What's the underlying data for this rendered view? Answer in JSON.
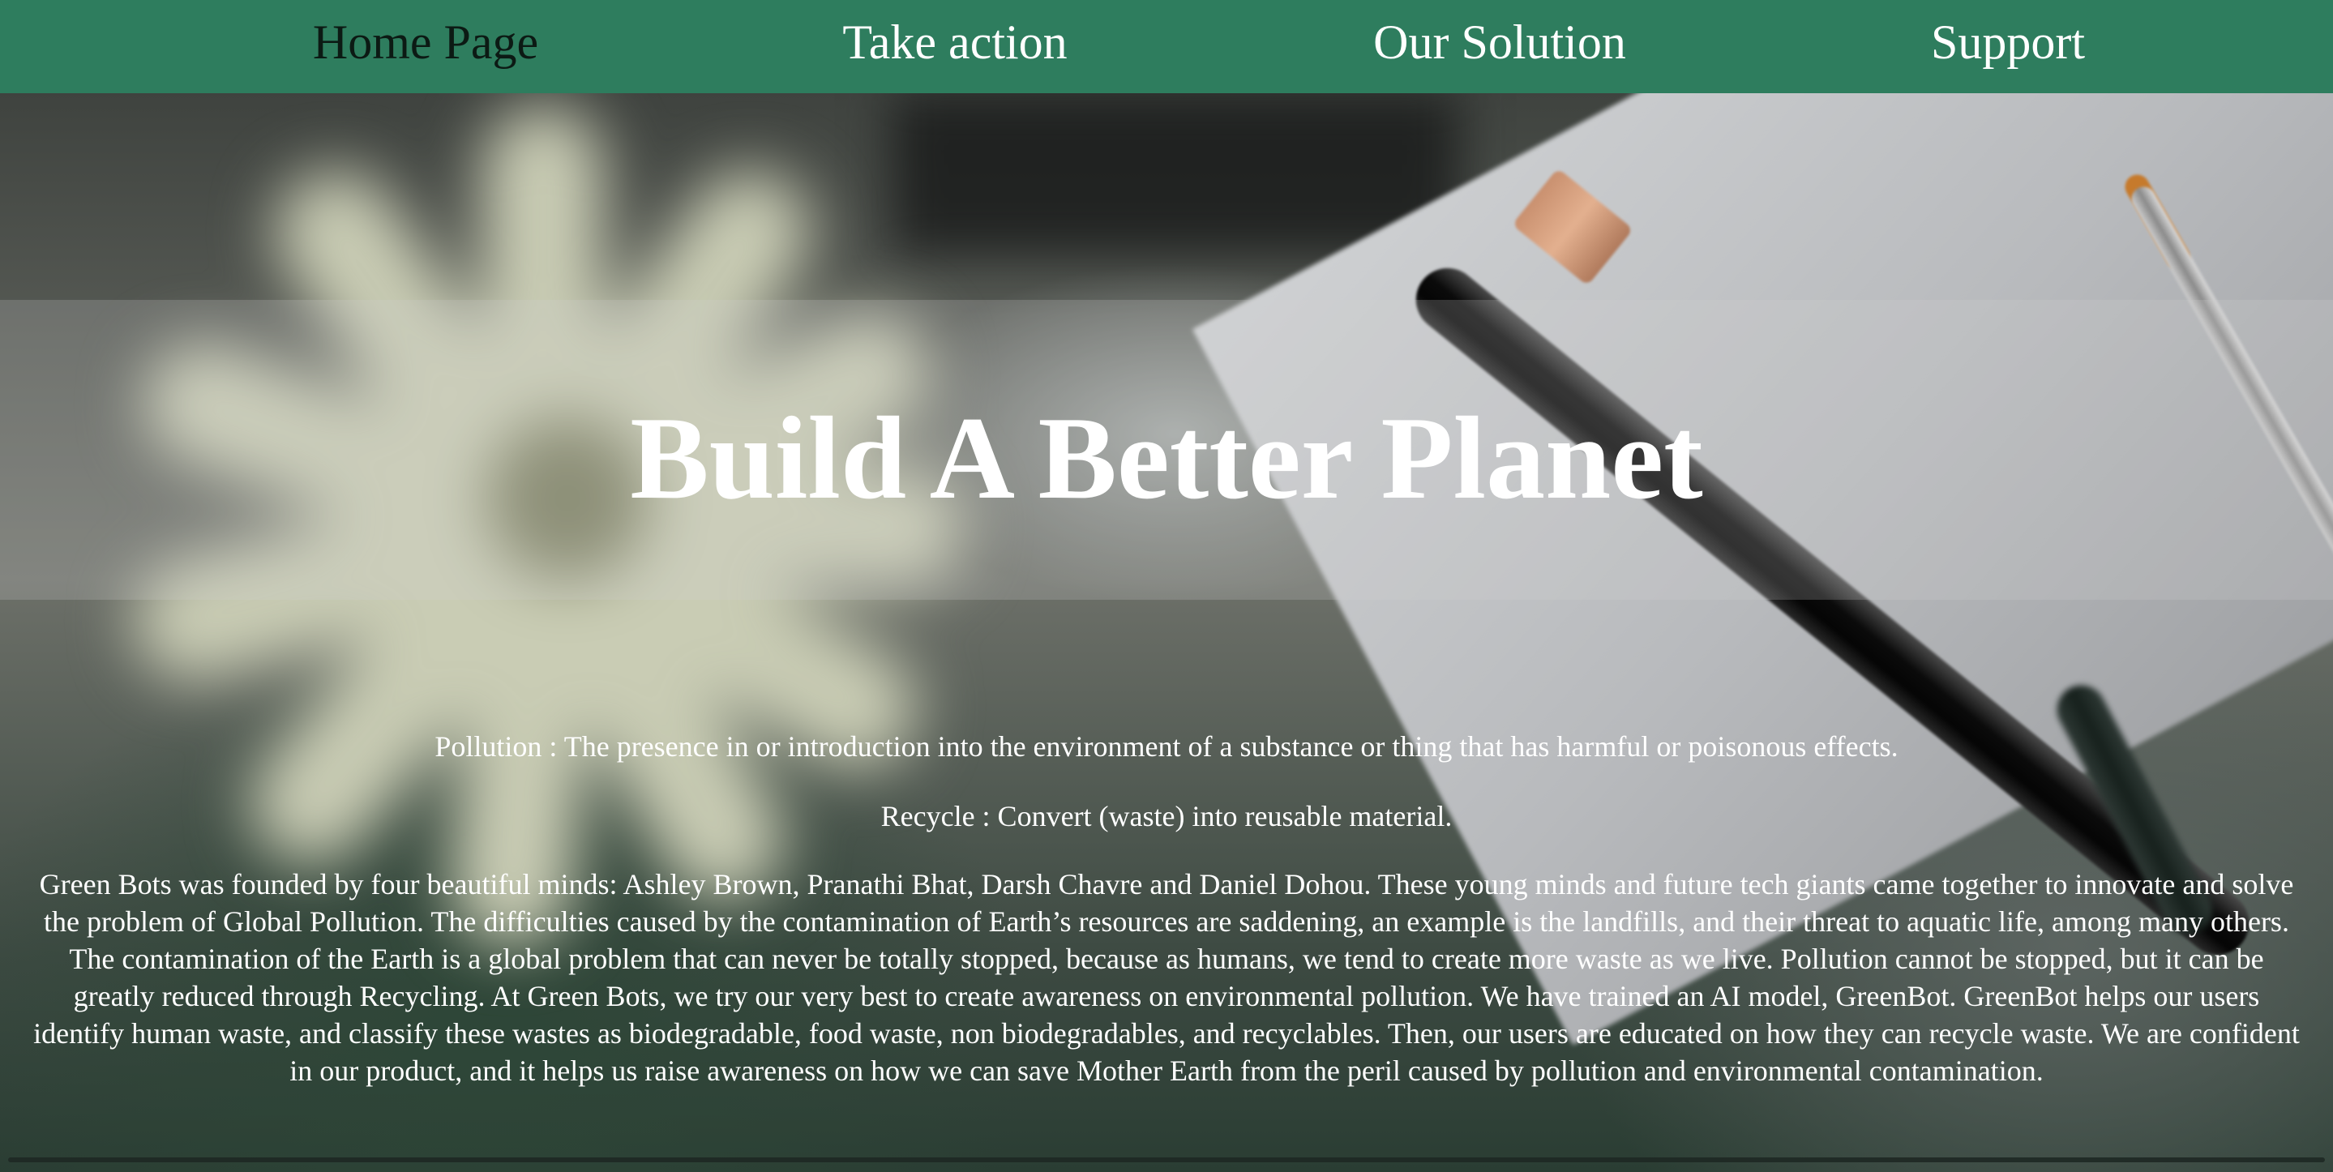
{
  "nav": {
    "items": [
      {
        "label": "Home Page",
        "active": true
      },
      {
        "label": "Take action",
        "active": false
      },
      {
        "label": "Our Solution",
        "active": false
      },
      {
        "label": "Support",
        "active": false
      }
    ],
    "background": "#2e7d5e",
    "active_color": "#0c1a14",
    "text_color": "#ffffff"
  },
  "hero": {
    "title": "Build A Better Planet",
    "definitions": [
      "Pollution : The presence in or introduction into the environment of a substance or thing that has harmful or poisonous effects.",
      "Recycle : Convert (waste) into reusable material."
    ],
    "about": "Green Bots was founded by four beautiful minds: Ashley Brown, Pranathi Bhat, Darsh Chavre and Daniel Dohou. These young minds and future tech giants came together to innovate and solve the problem of Global Pollution. The difficulties caused by the contamination of Earth’s resources are saddening, an example is the landfills, and their threat to aquatic life, among many others. The contamination of the Earth is a global problem that can never be totally stopped, because as humans, we tend to create more waste as we live. Pollution cannot be stopped, but it can be greatly reduced through Recycling. At Green Bots, we try our very best to create awareness on environmental pollution. We have trained an AI model, GreenBot. GreenBot helps our users identify human waste, and classify these wastes as biodegradable, food waste, non biodegradables, and recyclables. Then, our users are educated on how they can recycle waste. We are confident in our product, and it helps us raise awareness on how we can save Mother Earth from the peril caused by pollution and environmental contamination."
  }
}
